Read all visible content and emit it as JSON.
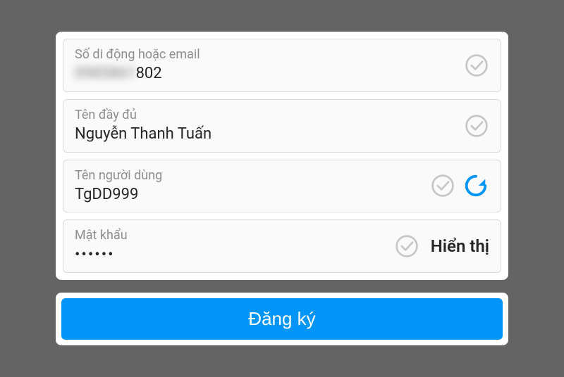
{
  "fields": {
    "contact": {
      "label": "Số di động hoặc email",
      "value_masked_prefix": "0985861",
      "value_visible_suffix": "802"
    },
    "fullname": {
      "label": "Tên đầy đủ",
      "value": "Nguyễn Thanh Tuấn"
    },
    "username": {
      "label": "Tên người dùng",
      "value": "TgDD999"
    },
    "password": {
      "label": "Mật khẩu",
      "value": "••••••",
      "show_label": "Hiển thị"
    }
  },
  "submit_label": "Đăng ký",
  "colors": {
    "accent": "#0095f6",
    "check_stroke": "#c7c7c7"
  }
}
